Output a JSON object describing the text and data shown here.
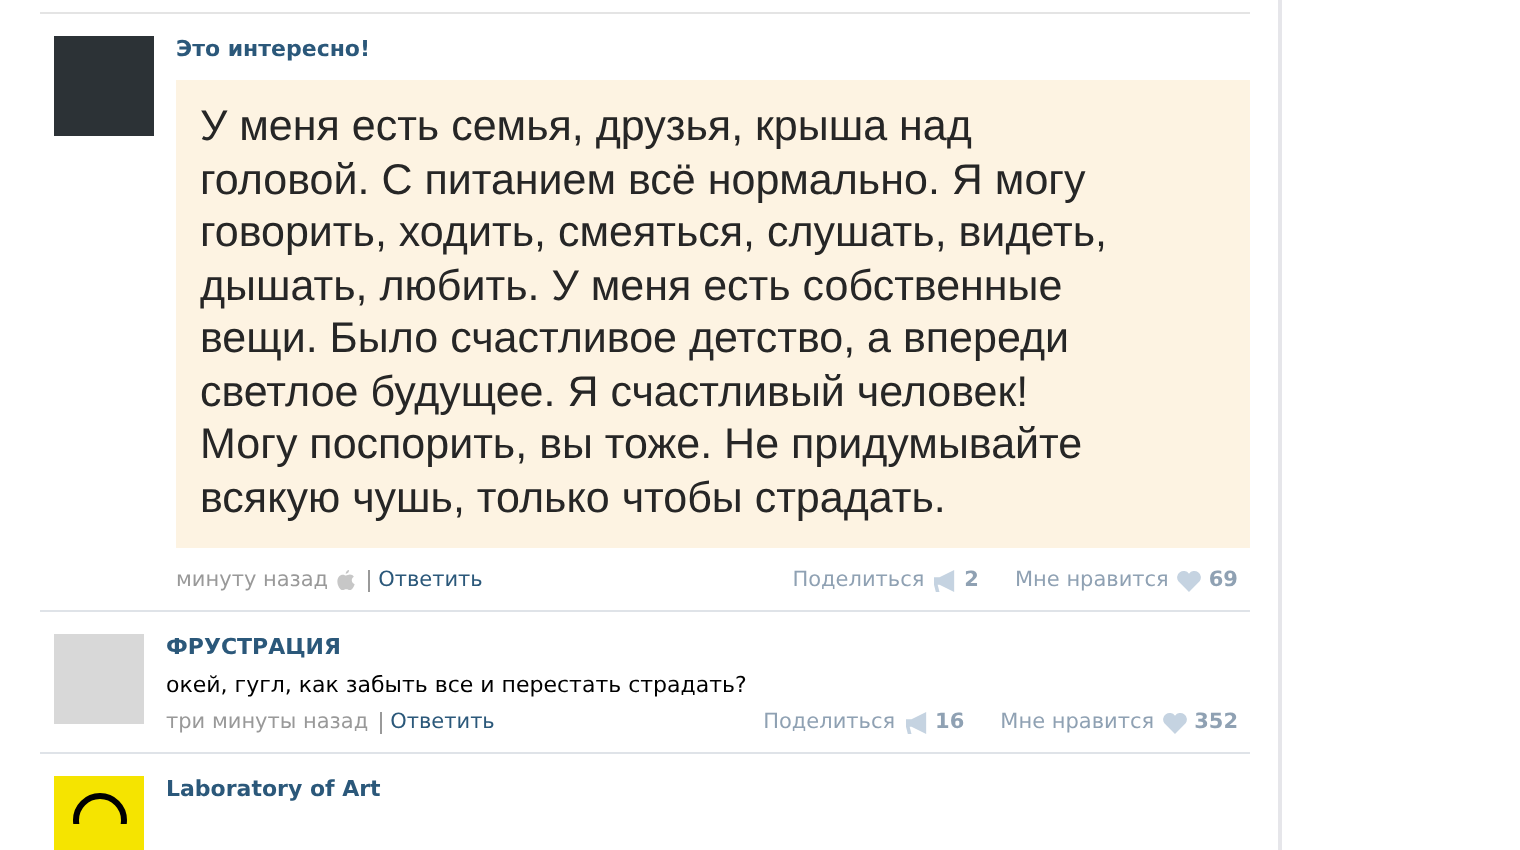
{
  "posts": [
    {
      "author": "Это интересно!",
      "avatar": {
        "kind": "dark"
      },
      "image_text_lines": [
        "У меня есть семья, друзья, крыша над",
        "головой. С питанием всё нормально. Я могу",
        "говорить, ходить, смеяться, слушать, видеть,",
        "дышать, любить. У меня есть собственные",
        "вещи. Было счастливое детство, а впереди",
        "светлое будущее. Я счастливый человек!",
        "Могу поспорить, вы тоже. Не придумывайте",
        "всякую чушь, только чтобы страдать."
      ],
      "time": "минуту назад",
      "posted_from_apple": true,
      "reply": "Ответить",
      "share": {
        "label": "Поделиться",
        "count": "2"
      },
      "like": {
        "label": "Мне нравится",
        "count": "69"
      }
    },
    {
      "author": "ФРУСТРАЦИЯ",
      "avatar": {
        "kind": "light"
      },
      "text": "окей, гугл, как забыть все и перестать страдать?",
      "time": "три минуты назад",
      "reply": "Ответить",
      "share": {
        "label": "Поделиться",
        "count": "16"
      },
      "like": {
        "label": "Мне нравится",
        "count": "352"
      }
    },
    {
      "author": "Laboratory of Art",
      "avatar": {
        "kind": "yellow"
      }
    }
  ]
}
